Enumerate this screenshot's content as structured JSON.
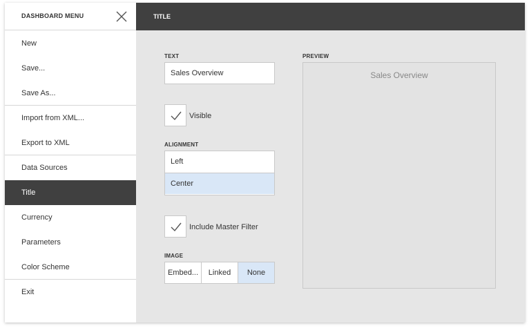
{
  "sidebar": {
    "title": "DASHBOARD MENU",
    "close_icon": "close-x-icon",
    "items": [
      {
        "label": "New"
      },
      {
        "label": "Save..."
      },
      {
        "label": "Save As..."
      },
      {
        "label": "Import from XML..."
      },
      {
        "label": "Export to XML"
      },
      {
        "label": "Data Sources"
      },
      {
        "label": "Title",
        "active": true
      },
      {
        "label": "Currency"
      },
      {
        "label": "Parameters"
      },
      {
        "label": "Color Scheme"
      },
      {
        "label": "Exit"
      }
    ]
  },
  "header": {
    "title": "TITLE"
  },
  "form": {
    "text_label": "TEXT",
    "text_value": "Sales Overview",
    "visible_label": "Visible",
    "visible_checked": true,
    "alignment_label": "ALIGNMENT",
    "alignment_options": [
      {
        "label": "Left"
      },
      {
        "label": "Center",
        "selected": true
      }
    ],
    "master_filter_label": "Include Master Filter",
    "master_filter_checked": true,
    "image_label": "IMAGE",
    "image_options": [
      {
        "label": "Embed..."
      },
      {
        "label": "Linked"
      },
      {
        "label": "None",
        "selected": true
      }
    ]
  },
  "preview": {
    "label": "PREVIEW",
    "title": "Sales Overview"
  },
  "colors": {
    "dark_bar": "#404040",
    "selected_bg": "#d9e7f7",
    "panel_bg": "#e6e6e6",
    "border": "#c8c8c8"
  }
}
